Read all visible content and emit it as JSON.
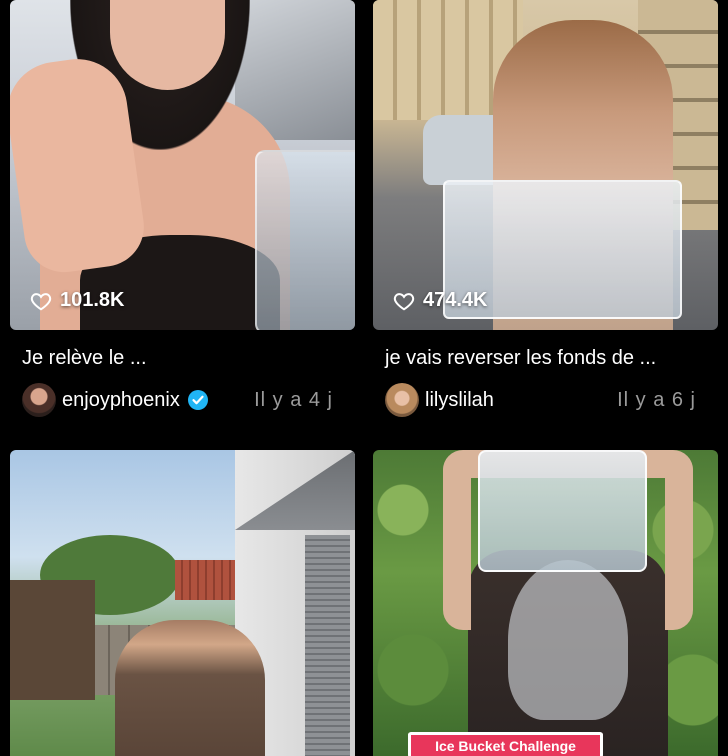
{
  "icons": {
    "like": "heart-outline-icon",
    "verified": "verified-badge-icon"
  },
  "colors": {
    "background": "#000000",
    "verified": "#20b5f5",
    "timestamp": "#9b9b9b",
    "banner": "#e8365b"
  },
  "videos": [
    {
      "likes": "101.8K",
      "title": "Je relève le ...",
      "username": "enjoyphoenix",
      "verified": true,
      "time": "Il y a 4 j"
    },
    {
      "likes": "474.4K",
      "title": "je vais reverser les fonds de ...",
      "username": "lilyslilah",
      "verified": false,
      "time": "Il y a 6 j"
    },
    {
      "likes": "",
      "title": "",
      "username": "",
      "time": ""
    },
    {
      "likes": "",
      "title": "",
      "username": "",
      "time": "",
      "banner": "Ice Bucket Challenge"
    }
  ]
}
